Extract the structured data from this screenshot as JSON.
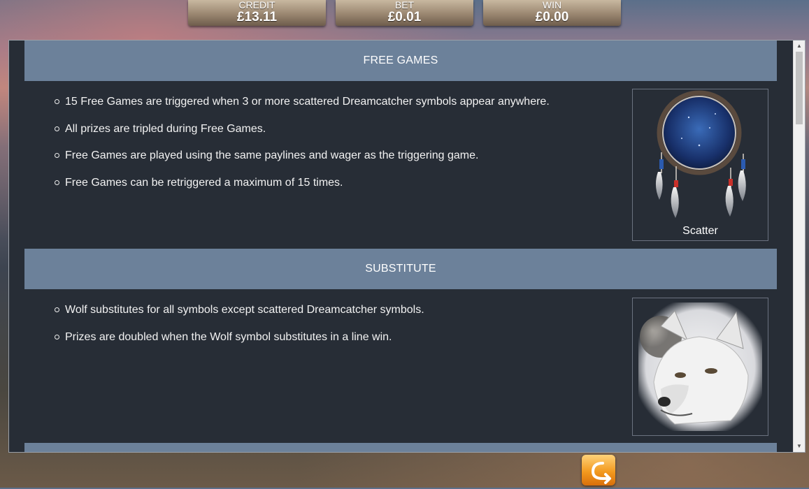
{
  "meters": {
    "credit": {
      "label": "CREDIT",
      "value": "£13.11"
    },
    "bet": {
      "label": "BET",
      "value": "£0.01"
    },
    "win": {
      "label": "WIN",
      "value": "£0.00"
    }
  },
  "sections": {
    "free_games": {
      "title": "FREE GAMES",
      "rules": [
        "15 Free Games are triggered when 3 or more scattered Dreamcatcher symbols appear anywhere.",
        "All prizes are tripled during Free Games.",
        "Free Games are played using the same paylines and wager as the triggering game.",
        "Free Games can be retriggered a maximum of 15 times."
      ],
      "symbol_caption": "Scatter",
      "symbol_icon": "dreamcatcher-icon"
    },
    "substitute": {
      "title": "SUBSTITUTE",
      "rules": [
        "Wolf substitutes for all symbols except scattered Dreamcatcher symbols.",
        "Prizes are doubled when the Wolf symbol substitutes in a line win."
      ],
      "symbol_icon": "wolf-icon"
    }
  },
  "colors": {
    "panel_bg": "#272d36",
    "header_bg": "#6c819a",
    "button_accent": "#f39a1f"
  },
  "back_button_icon": "return-arrow-icon"
}
